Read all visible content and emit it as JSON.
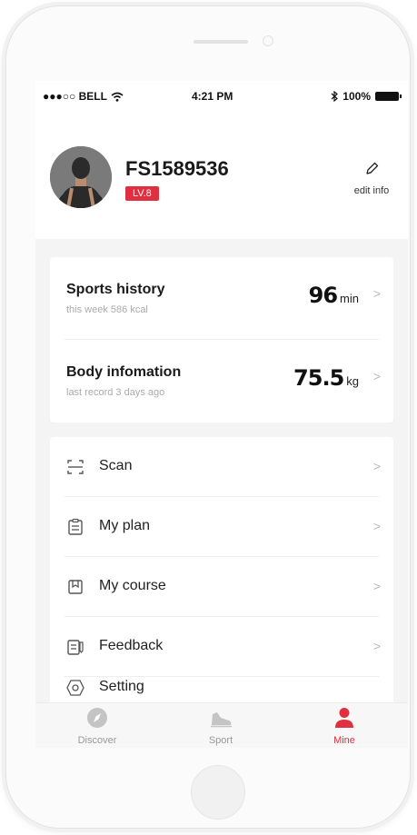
{
  "status_bar": {
    "carrier": "●●●○○ BELL",
    "time": "4:21 PM",
    "battery": "100%"
  },
  "profile": {
    "username": "FS1589536",
    "level": "LV.8",
    "edit_label": "edit info"
  },
  "stats": [
    {
      "title": "Sports history",
      "subtitle": "this week 586 kcal",
      "value": "96",
      "unit": "min"
    },
    {
      "title": "Body infomation",
      "subtitle": "last record 3 days ago",
      "value": "75.5",
      "unit": "kg"
    }
  ],
  "menu": [
    {
      "label": "Scan",
      "icon": "scan-icon"
    },
    {
      "label": "My plan",
      "icon": "clipboard-icon"
    },
    {
      "label": "My course",
      "icon": "bookmark-icon"
    },
    {
      "label": "Feedback",
      "icon": "feedback-icon"
    },
    {
      "label": "Setting",
      "icon": "settings-icon"
    }
  ],
  "tabs": [
    {
      "label": "Discover",
      "icon": "compass-icon",
      "active": false
    },
    {
      "label": "Sport",
      "icon": "shoe-icon",
      "active": false
    },
    {
      "label": "Mine",
      "icon": "person-icon",
      "active": true
    }
  ],
  "colors": {
    "accent": "#e03040",
    "background": "#f4f4f4",
    "card": "#ffffff",
    "muted_text": "#aaaaaa"
  }
}
